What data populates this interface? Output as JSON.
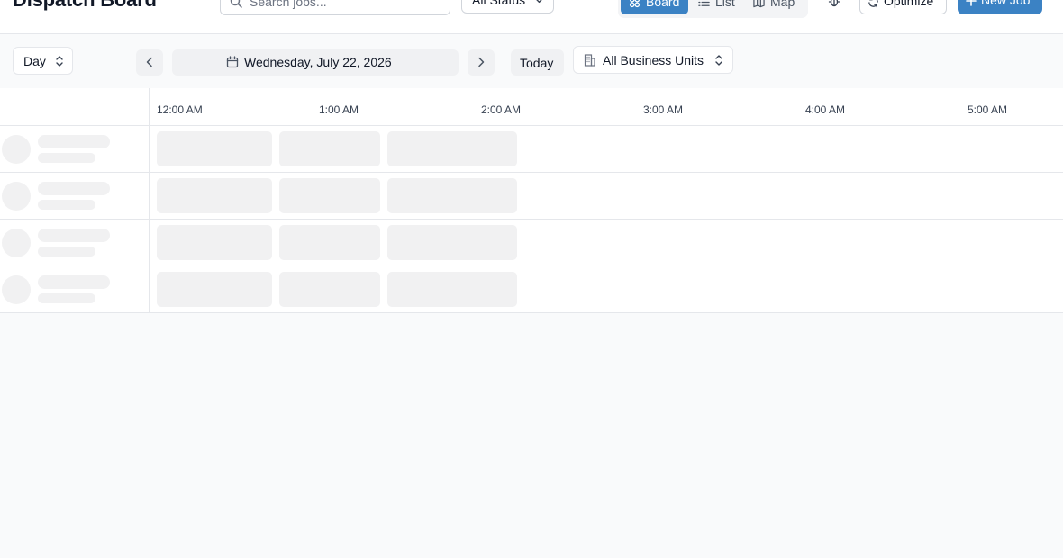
{
  "header": {
    "title": "Dispatch Board",
    "search": {
      "placeholder": "Search jobs...",
      "value": ""
    },
    "status_filter": {
      "selected": "All Status"
    },
    "view_toggle": {
      "items": [
        {
          "label": "Board",
          "icon": "board-icon",
          "active": true
        },
        {
          "label": "List",
          "icon": "list-icon",
          "active": false
        },
        {
          "label": "Map",
          "icon": "map-icon",
          "active": false
        }
      ]
    },
    "debug_icon": "bug-icon",
    "optimize_label": "Optimize",
    "new_job_label": "New Job"
  },
  "toolbar": {
    "period": {
      "selected": "Day"
    },
    "date_label": "Wednesday, July 22, 2026",
    "today_label": "Today",
    "business_unit": {
      "selected": "All Business Units"
    }
  },
  "timeline": {
    "hours": [
      "12:00 AM",
      "1:00 AM",
      "2:00 AM",
      "3:00 AM",
      "4:00 AM",
      "5:00 AM"
    ]
  },
  "loading_rows": 4,
  "colors": {
    "accent": "#3b82c4",
    "skeleton": "#f1f1f2",
    "page_bg": "#f9fafb",
    "border": "#e5e7eb"
  }
}
